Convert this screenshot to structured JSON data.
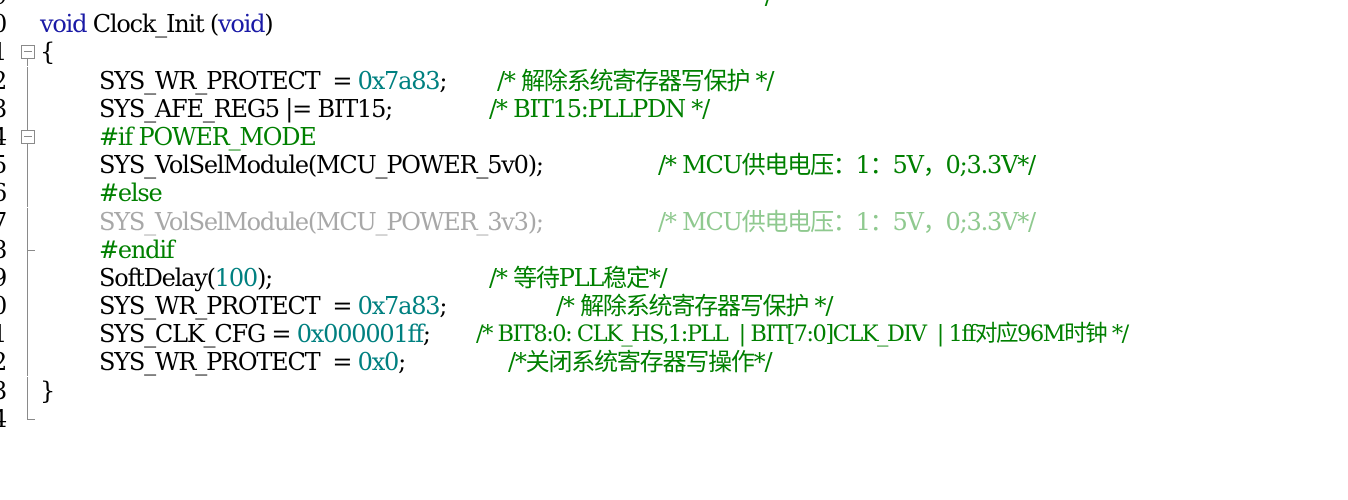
{
  "editor": {
    "line_numbers": [
      "9",
      "0",
      "1",
      "2",
      "3",
      "4",
      "5",
      "6",
      "7",
      "8",
      "9",
      "0",
      "1",
      "2",
      "3",
      "4"
    ],
    "lines": [
      {
        "text": "******************************************************************/"
      },
      {
        "kw1": "void",
        "name": "Clock_Init",
        "paren_open": "(",
        "kw2": "void",
        "paren_close": ")"
      },
      {
        "text": "{"
      },
      {
        "code": "SYS_WR_PROTECT  = ",
        "num": "0x7a83",
        "tail": ";",
        "comment": "/* 解除系统寄存器写保护 */"
      },
      {
        "code": "SYS_AFE_REG5 |= BIT15;",
        "comment": "/* BIT15:PLLPDN */"
      },
      {
        "text": "#if POWER_MODE"
      },
      {
        "code": "SYS_VolSelModule(MCU_POWER_5v0);",
        "comment": "/* MCU供电电压：1：5V，0;3.3V*/"
      },
      {
        "text": "#else"
      },
      {
        "code": "SYS_VolSelModule(MCU_POWER_3v3);",
        "comment": "/* MCU供电电压：1：5V，0;3.3V*/"
      },
      {
        "text": "#endif"
      },
      {
        "code": "SoftDelay(",
        "num": "100",
        "tail": ");",
        "comment": "/* 等待PLL稳定*/"
      },
      {
        "code": "SYS_WR_PROTECT  = ",
        "num": "0x7a83",
        "tail": ";",
        "comment": "/* 解除系统寄存器写保护 */"
      },
      {
        "code": "SYS_CLK_CFG = ",
        "num": "0x000001ff",
        "tail": ";",
        "comment": "/* BIT8:0: CLK_HS,1:PLL  | BIT[7:0]CLK_DIV  | 1ff对应96M时钟 */"
      },
      {
        "code": "SYS_WR_PROTECT  = ",
        "num": "0x0",
        "tail": ";",
        "comment": "/*关闭系统寄存器写操作*/"
      },
      {
        "text": "}"
      },
      {
        "text": ""
      }
    ]
  },
  "colors": {
    "keyword": "#1a1aa6",
    "number": "#008080",
    "comment": "#008000",
    "inactive": "#a8a8a8",
    "text": "#000000"
  }
}
